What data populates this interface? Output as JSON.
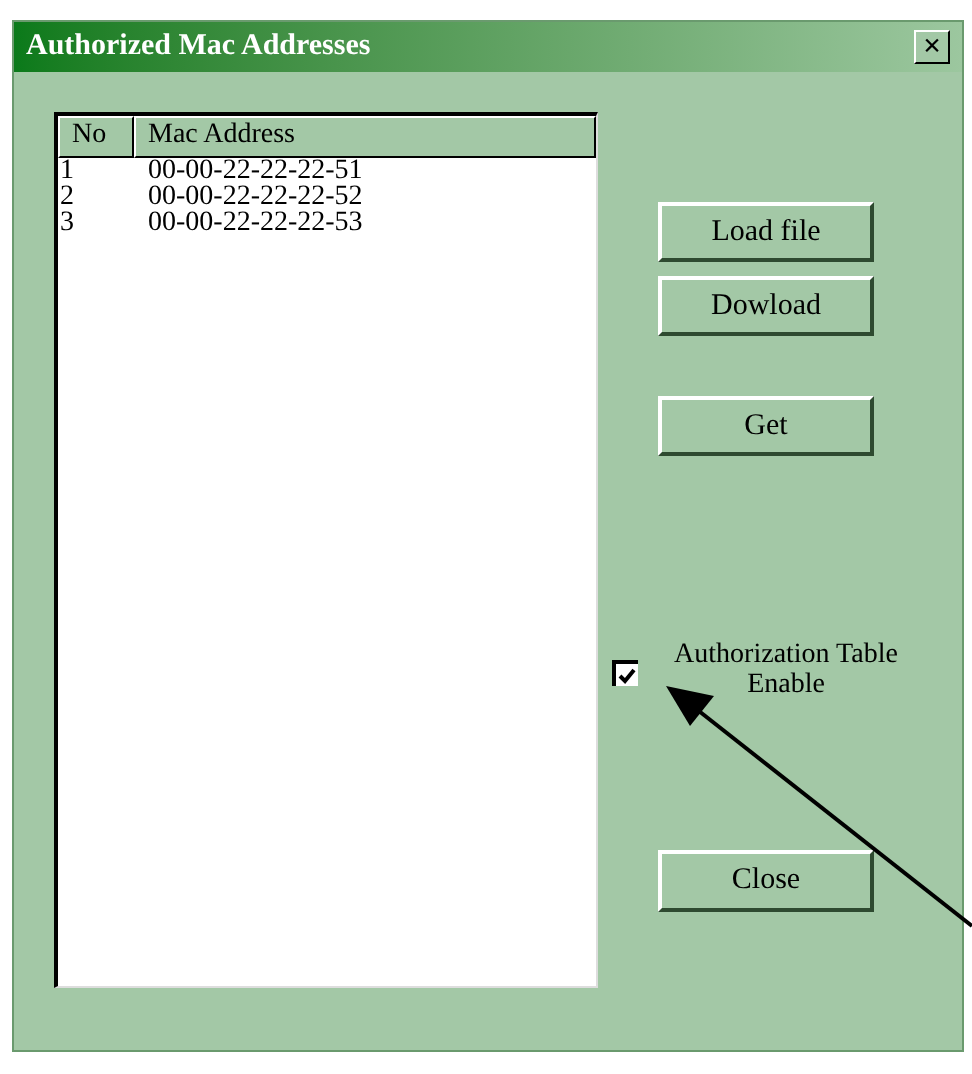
{
  "window": {
    "title": "Authorized Mac Addresses",
    "close": "×"
  },
  "table": {
    "columns": [
      "No",
      "Mac Address"
    ],
    "rows": [
      {
        "no": "1",
        "mac": "00-00-22-22-22-51"
      },
      {
        "no": "2",
        "mac": "00-00-22-22-22-52"
      },
      {
        "no": "3",
        "mac": "00-00-22-22-22-53"
      }
    ]
  },
  "buttons": [
    {
      "label": "Load file"
    },
    {
      "label": "Dowload"
    },
    {
      "label": "Get"
    }
  ],
  "checkbox": {
    "label_lines": [
      "Authorization Table",
      "Enable"
    ],
    "checked": true
  },
  "close_button": {
    "label": "Close"
  }
}
